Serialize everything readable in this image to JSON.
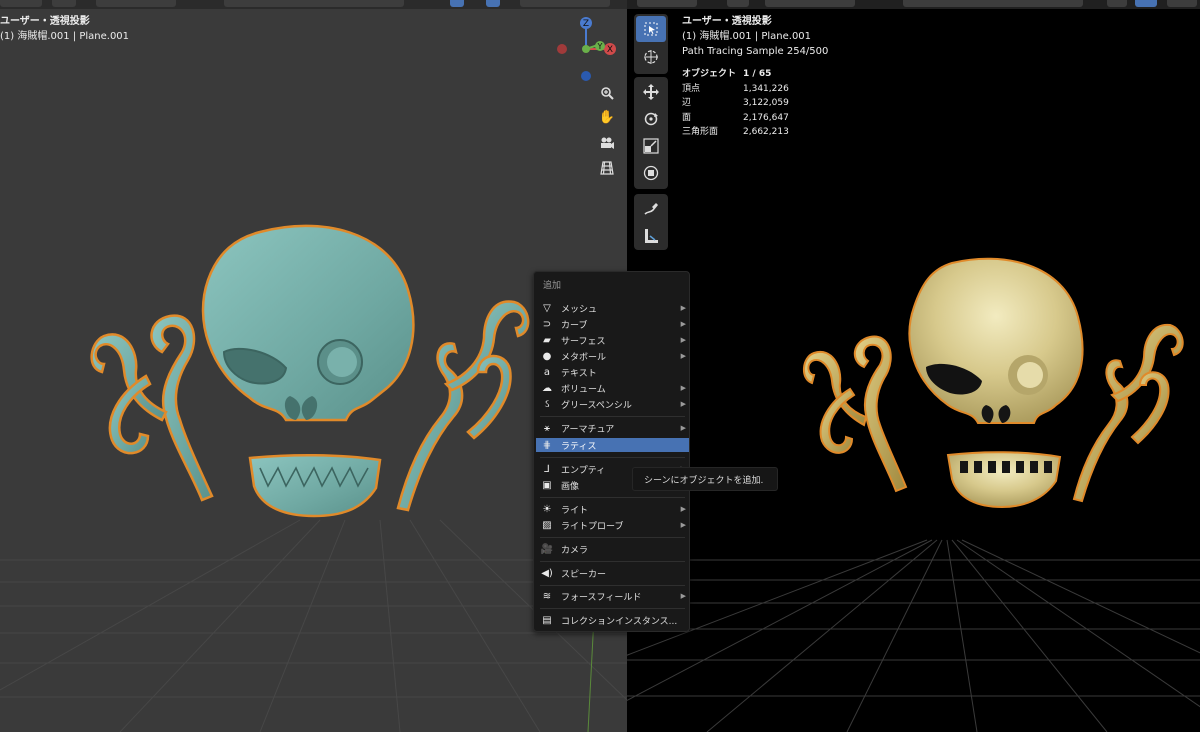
{
  "left_viewport": {
    "title": "ユーザー・透視投影",
    "subtitle": "(1) 海賊帽.001 | Plane.001",
    "gizmo": {
      "z": "Z",
      "y": "Y",
      "x": "X"
    }
  },
  "right_viewport": {
    "title": "ユーザー・透視投影",
    "subtitle": "(1) 海賊帽.001 | Plane.001",
    "render_status": "Path Tracing Sample 254/500",
    "stats": [
      {
        "label": "オブジェクト",
        "value": "1 / 65"
      },
      {
        "label": "頂点",
        "value": "1,341,226"
      },
      {
        "label": "辺",
        "value": "3,122,059"
      },
      {
        "label": "面",
        "value": "2,176,647"
      },
      {
        "label": "三角形面",
        "value": "2,662,213"
      }
    ]
  },
  "add_menu": {
    "title": "追加",
    "items": [
      {
        "label": "メッシュ",
        "icon": "mesh-icon"
      },
      {
        "label": "カーブ",
        "icon": "curve-icon"
      },
      {
        "label": "サーフェス",
        "icon": "surface-icon"
      },
      {
        "label": "メタボール",
        "icon": "metaball-icon"
      },
      {
        "label": "テキスト",
        "icon": "text-icon"
      },
      {
        "label": "ボリューム",
        "icon": "volume-icon"
      },
      {
        "label": "グリースペンシル",
        "icon": "grease-pencil-icon"
      },
      {
        "label": "アーマチュア",
        "icon": "armature-icon"
      },
      {
        "label": "ラティス",
        "icon": "lattice-icon"
      },
      {
        "label": "エンプティ",
        "icon": "empty-icon"
      },
      {
        "label": "画像",
        "icon": "image-icon"
      },
      {
        "label": "ライト",
        "icon": "light-icon"
      },
      {
        "label": "ライトプローブ",
        "icon": "light-probe-icon"
      },
      {
        "label": "カメラ",
        "icon": "camera-icon"
      },
      {
        "label": "スピーカー",
        "icon": "speaker-icon"
      },
      {
        "label": "フォースフィールド",
        "icon": "force-field-icon"
      },
      {
        "label": "コレクションインスタンス...",
        "icon": "collection-icon"
      }
    ],
    "highlighted": "ラティス"
  },
  "tooltip": {
    "text": "シーンにオブジェクトを追加."
  },
  "colors": {
    "accent": "#4772b3",
    "skull_left": "#7ab3ad",
    "skull_right": "#d4c88a",
    "outline": "#e08a2a"
  }
}
